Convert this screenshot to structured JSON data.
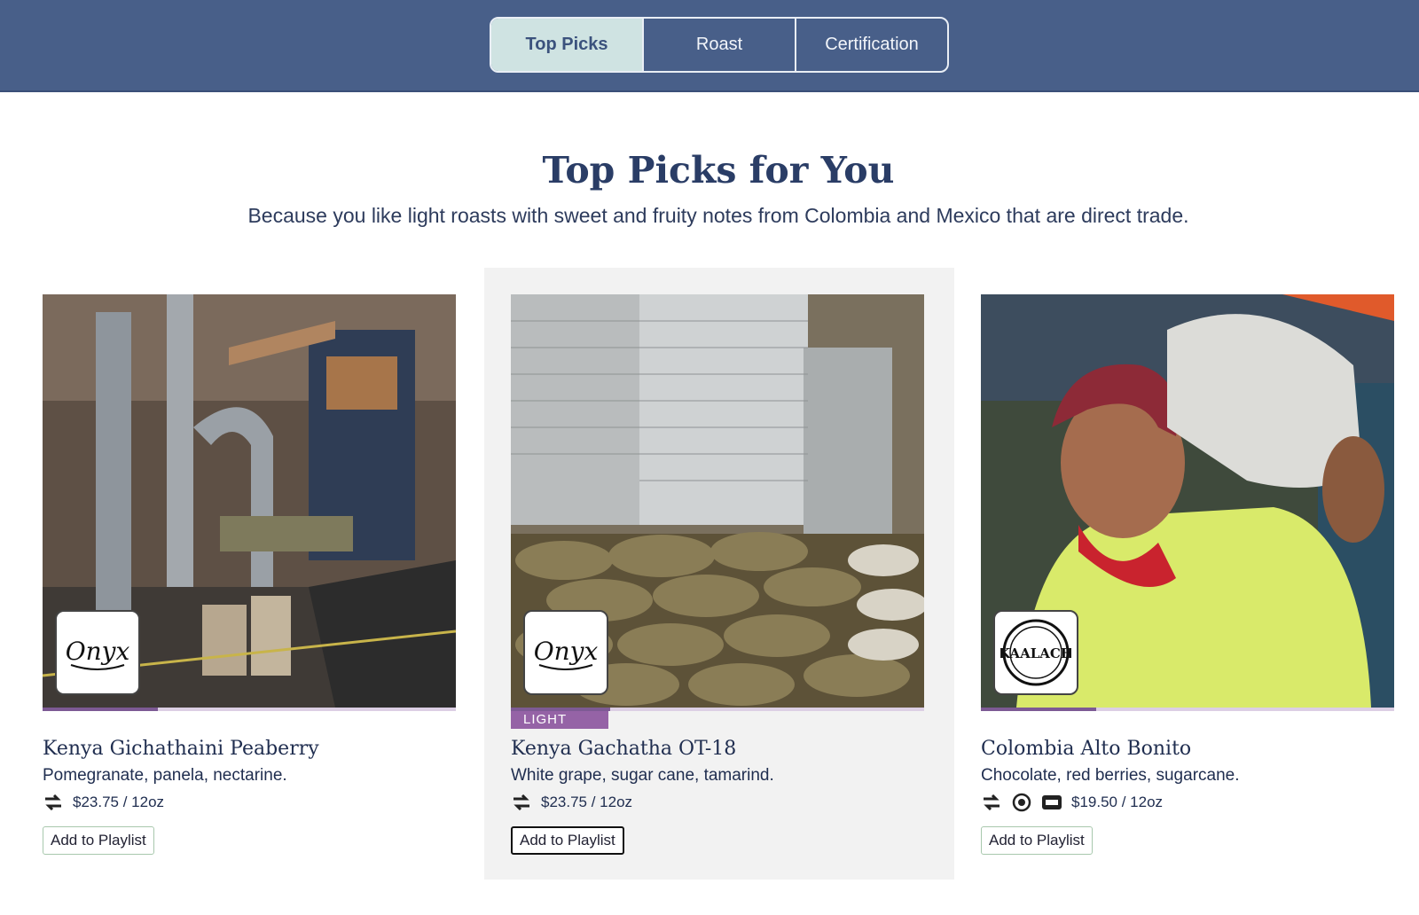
{
  "nav": {
    "tabs": [
      {
        "label": "Top Picks",
        "active": true
      },
      {
        "label": "Roast",
        "active": false
      },
      {
        "label": "Certification",
        "active": false
      }
    ]
  },
  "main": {
    "title": "Top Picks for You",
    "subtitle": "Because you like light roasts with sweet and fruity notes from Colombia and Mexico that are direct trade."
  },
  "cards": [
    {
      "name": "Kenya Gichathaini Peaberry",
      "notes": "Pomegranate, panela, nectarine.",
      "price": "$23.75 / 12oz",
      "button": "Add to Playlist",
      "roaster_logo": "onyx-coffee-lab-logo",
      "roast_tag": "",
      "progress": 0.28,
      "icons": [
        "direct-trade-icon"
      ]
    },
    {
      "name": "Kenya Gachatha OT-18",
      "notes": "White grape, sugar cane, tamarind.",
      "price": "$23.75 / 12oz",
      "button": "Add to Playlist",
      "roaster_logo": "onyx-coffee-lab-logo",
      "roast_tag": "LIGHT",
      "progress": 0.24,
      "icons": [
        "direct-trade-icon"
      ]
    },
    {
      "name": "Colombia Alto Bonito",
      "notes": "Chocolate, red berries, sugarcane.",
      "price": "$19.50 / 12oz",
      "button": "Add to Playlist",
      "roaster_logo": "kaalach-coffee-logo",
      "roast_tag": "",
      "progress": 0.28,
      "icons": [
        "direct-trade-icon",
        "rainforest-certified-icon",
        "utz-certified-icon"
      ]
    }
  ],
  "colors": {
    "navbar": "#485f89",
    "active_tab": "#cfe3e2",
    "heading": "#2a3d66",
    "roast_tag": "#9563a6",
    "progress": "#7d5a94"
  }
}
